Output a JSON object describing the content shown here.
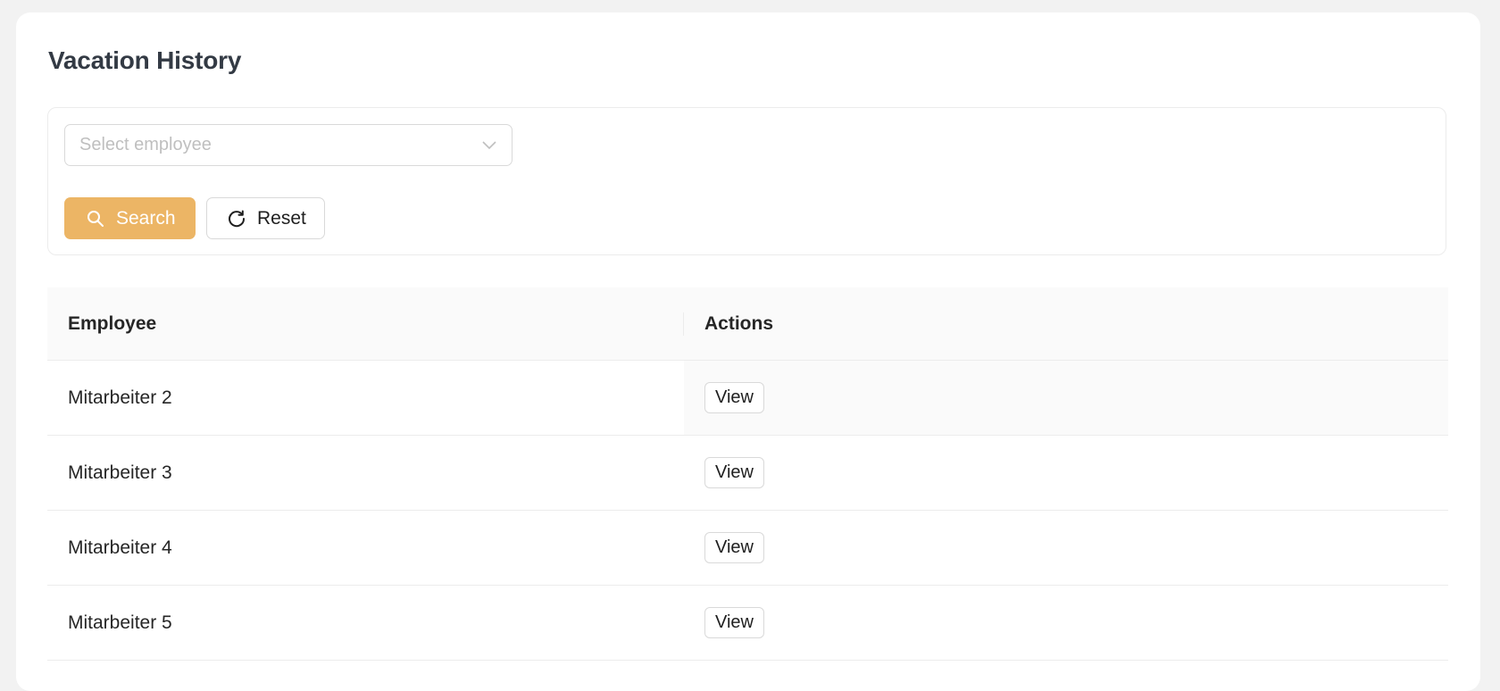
{
  "page": {
    "title": "Vacation History"
  },
  "filter": {
    "employee_select": {
      "placeholder": "Select employee",
      "icon": "chevron-down-icon"
    },
    "search_button": {
      "label": "Search",
      "icon": "search-icon",
      "color": "#ecb565"
    },
    "reset_button": {
      "label": "Reset",
      "icon": "reset-icon"
    }
  },
  "table": {
    "columns": [
      "Employee",
      "Actions"
    ],
    "rows": [
      {
        "employee": "Mitarbeiter 2",
        "action": "View"
      },
      {
        "employee": "Mitarbeiter 3",
        "action": "View"
      },
      {
        "employee": "Mitarbeiter 4",
        "action": "View"
      },
      {
        "employee": "Mitarbeiter 5",
        "action": "View"
      }
    ]
  }
}
